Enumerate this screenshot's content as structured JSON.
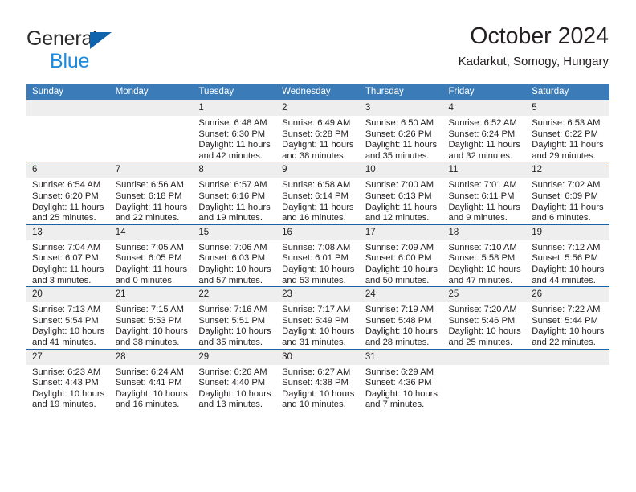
{
  "brand": {
    "line1": "General",
    "line2": "Blue",
    "logo_color": "#1064ad",
    "accent_color": "#1e8ade"
  },
  "header": {
    "title": "October 2024",
    "subtitle": "Kadarkut, Somogy, Hungary"
  },
  "theme": {
    "header_bar": "#3b7cb8",
    "row_divider": "#1a62a8",
    "daynum_band": "#eeeeee",
    "text": "#231f20"
  },
  "calendar": {
    "weekday_headers": [
      "Sunday",
      "Monday",
      "Tuesday",
      "Wednesday",
      "Thursday",
      "Friday",
      "Saturday"
    ],
    "weeks": [
      [
        {
          "day": "",
          "sunrise": "",
          "sunset": "",
          "daylight": ""
        },
        {
          "day": "",
          "sunrise": "",
          "sunset": "",
          "daylight": ""
        },
        {
          "day": "1",
          "sunrise": "Sunrise: 6:48 AM",
          "sunset": "Sunset: 6:30 PM",
          "daylight": "Daylight: 11 hours and 42 minutes."
        },
        {
          "day": "2",
          "sunrise": "Sunrise: 6:49 AM",
          "sunset": "Sunset: 6:28 PM",
          "daylight": "Daylight: 11 hours and 38 minutes."
        },
        {
          "day": "3",
          "sunrise": "Sunrise: 6:50 AM",
          "sunset": "Sunset: 6:26 PM",
          "daylight": "Daylight: 11 hours and 35 minutes."
        },
        {
          "day": "4",
          "sunrise": "Sunrise: 6:52 AM",
          "sunset": "Sunset: 6:24 PM",
          "daylight": "Daylight: 11 hours and 32 minutes."
        },
        {
          "day": "5",
          "sunrise": "Sunrise: 6:53 AM",
          "sunset": "Sunset: 6:22 PM",
          "daylight": "Daylight: 11 hours and 29 minutes."
        }
      ],
      [
        {
          "day": "6",
          "sunrise": "Sunrise: 6:54 AM",
          "sunset": "Sunset: 6:20 PM",
          "daylight": "Daylight: 11 hours and 25 minutes."
        },
        {
          "day": "7",
          "sunrise": "Sunrise: 6:56 AM",
          "sunset": "Sunset: 6:18 PM",
          "daylight": "Daylight: 11 hours and 22 minutes."
        },
        {
          "day": "8",
          "sunrise": "Sunrise: 6:57 AM",
          "sunset": "Sunset: 6:16 PM",
          "daylight": "Daylight: 11 hours and 19 minutes."
        },
        {
          "day": "9",
          "sunrise": "Sunrise: 6:58 AM",
          "sunset": "Sunset: 6:14 PM",
          "daylight": "Daylight: 11 hours and 16 minutes."
        },
        {
          "day": "10",
          "sunrise": "Sunrise: 7:00 AM",
          "sunset": "Sunset: 6:13 PM",
          "daylight": "Daylight: 11 hours and 12 minutes."
        },
        {
          "day": "11",
          "sunrise": "Sunrise: 7:01 AM",
          "sunset": "Sunset: 6:11 PM",
          "daylight": "Daylight: 11 hours and 9 minutes."
        },
        {
          "day": "12",
          "sunrise": "Sunrise: 7:02 AM",
          "sunset": "Sunset: 6:09 PM",
          "daylight": "Daylight: 11 hours and 6 minutes."
        }
      ],
      [
        {
          "day": "13",
          "sunrise": "Sunrise: 7:04 AM",
          "sunset": "Sunset: 6:07 PM",
          "daylight": "Daylight: 11 hours and 3 minutes."
        },
        {
          "day": "14",
          "sunrise": "Sunrise: 7:05 AM",
          "sunset": "Sunset: 6:05 PM",
          "daylight": "Daylight: 11 hours and 0 minutes."
        },
        {
          "day": "15",
          "sunrise": "Sunrise: 7:06 AM",
          "sunset": "Sunset: 6:03 PM",
          "daylight": "Daylight: 10 hours and 57 minutes."
        },
        {
          "day": "16",
          "sunrise": "Sunrise: 7:08 AM",
          "sunset": "Sunset: 6:01 PM",
          "daylight": "Daylight: 10 hours and 53 minutes."
        },
        {
          "day": "17",
          "sunrise": "Sunrise: 7:09 AM",
          "sunset": "Sunset: 6:00 PM",
          "daylight": "Daylight: 10 hours and 50 minutes."
        },
        {
          "day": "18",
          "sunrise": "Sunrise: 7:10 AM",
          "sunset": "Sunset: 5:58 PM",
          "daylight": "Daylight: 10 hours and 47 minutes."
        },
        {
          "day": "19",
          "sunrise": "Sunrise: 7:12 AM",
          "sunset": "Sunset: 5:56 PM",
          "daylight": "Daylight: 10 hours and 44 minutes."
        }
      ],
      [
        {
          "day": "20",
          "sunrise": "Sunrise: 7:13 AM",
          "sunset": "Sunset: 5:54 PM",
          "daylight": "Daylight: 10 hours and 41 minutes."
        },
        {
          "day": "21",
          "sunrise": "Sunrise: 7:15 AM",
          "sunset": "Sunset: 5:53 PM",
          "daylight": "Daylight: 10 hours and 38 minutes."
        },
        {
          "day": "22",
          "sunrise": "Sunrise: 7:16 AM",
          "sunset": "Sunset: 5:51 PM",
          "daylight": "Daylight: 10 hours and 35 minutes."
        },
        {
          "day": "23",
          "sunrise": "Sunrise: 7:17 AM",
          "sunset": "Sunset: 5:49 PM",
          "daylight": "Daylight: 10 hours and 31 minutes."
        },
        {
          "day": "24",
          "sunrise": "Sunrise: 7:19 AM",
          "sunset": "Sunset: 5:48 PM",
          "daylight": "Daylight: 10 hours and 28 minutes."
        },
        {
          "day": "25",
          "sunrise": "Sunrise: 7:20 AM",
          "sunset": "Sunset: 5:46 PM",
          "daylight": "Daylight: 10 hours and 25 minutes."
        },
        {
          "day": "26",
          "sunrise": "Sunrise: 7:22 AM",
          "sunset": "Sunset: 5:44 PM",
          "daylight": "Daylight: 10 hours and 22 minutes."
        }
      ],
      [
        {
          "day": "27",
          "sunrise": "Sunrise: 6:23 AM",
          "sunset": "Sunset: 4:43 PM",
          "daylight": "Daylight: 10 hours and 19 minutes."
        },
        {
          "day": "28",
          "sunrise": "Sunrise: 6:24 AM",
          "sunset": "Sunset: 4:41 PM",
          "daylight": "Daylight: 10 hours and 16 minutes."
        },
        {
          "day": "29",
          "sunrise": "Sunrise: 6:26 AM",
          "sunset": "Sunset: 4:40 PM",
          "daylight": "Daylight: 10 hours and 13 minutes."
        },
        {
          "day": "30",
          "sunrise": "Sunrise: 6:27 AM",
          "sunset": "Sunset: 4:38 PM",
          "daylight": "Daylight: 10 hours and 10 minutes."
        },
        {
          "day": "31",
          "sunrise": "Sunrise: 6:29 AM",
          "sunset": "Sunset: 4:36 PM",
          "daylight": "Daylight: 10 hours and 7 minutes."
        },
        {
          "day": "",
          "sunrise": "",
          "sunset": "",
          "daylight": ""
        },
        {
          "day": "",
          "sunrise": "",
          "sunset": "",
          "daylight": ""
        }
      ]
    ]
  }
}
